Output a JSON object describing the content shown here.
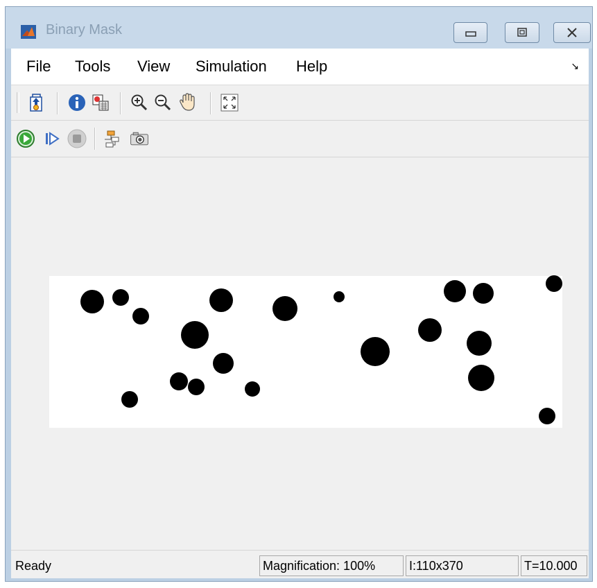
{
  "window": {
    "title": "Binary Mask",
    "app_icon": "matlab-logo-icon"
  },
  "window_controls": [
    {
      "icon": "minimize-icon",
      "glyph": "▭"
    },
    {
      "icon": "maximize-icon",
      "glyph": "▣"
    },
    {
      "icon": "close-icon",
      "glyph": "✕"
    }
  ],
  "menu": {
    "items": [
      "File",
      "Tools",
      "View",
      "Simulation",
      "Help"
    ],
    "dock_glyph": "↘"
  },
  "toolbar1": {
    "buttons": [
      "open-parent-model-icon",
      "info-icon",
      "export-to-workspace-icon",
      "zoom-in-icon",
      "zoom-out-icon",
      "pan-hand-icon",
      "fit-to-view-icon"
    ]
  },
  "toolbar2": {
    "buttons": [
      "run-icon",
      "step-forward-icon",
      "stop-icon",
      "highlight-signal-icon",
      "snapshot-camera-icon"
    ]
  },
  "image": {
    "description_type": "binary mask",
    "background": "#ffffff",
    "foreground": "#000000"
  },
  "status": {
    "state": "Ready",
    "magnification": "Magnification: 100%",
    "image_info": "I:110x370",
    "time": "T=10.000"
  },
  "colors": {
    "titlebar": "#c8d9ea",
    "frame": "#bcd0e4",
    "client_bg": "#f0f0f0",
    "run_green": "#2e9b2e"
  }
}
